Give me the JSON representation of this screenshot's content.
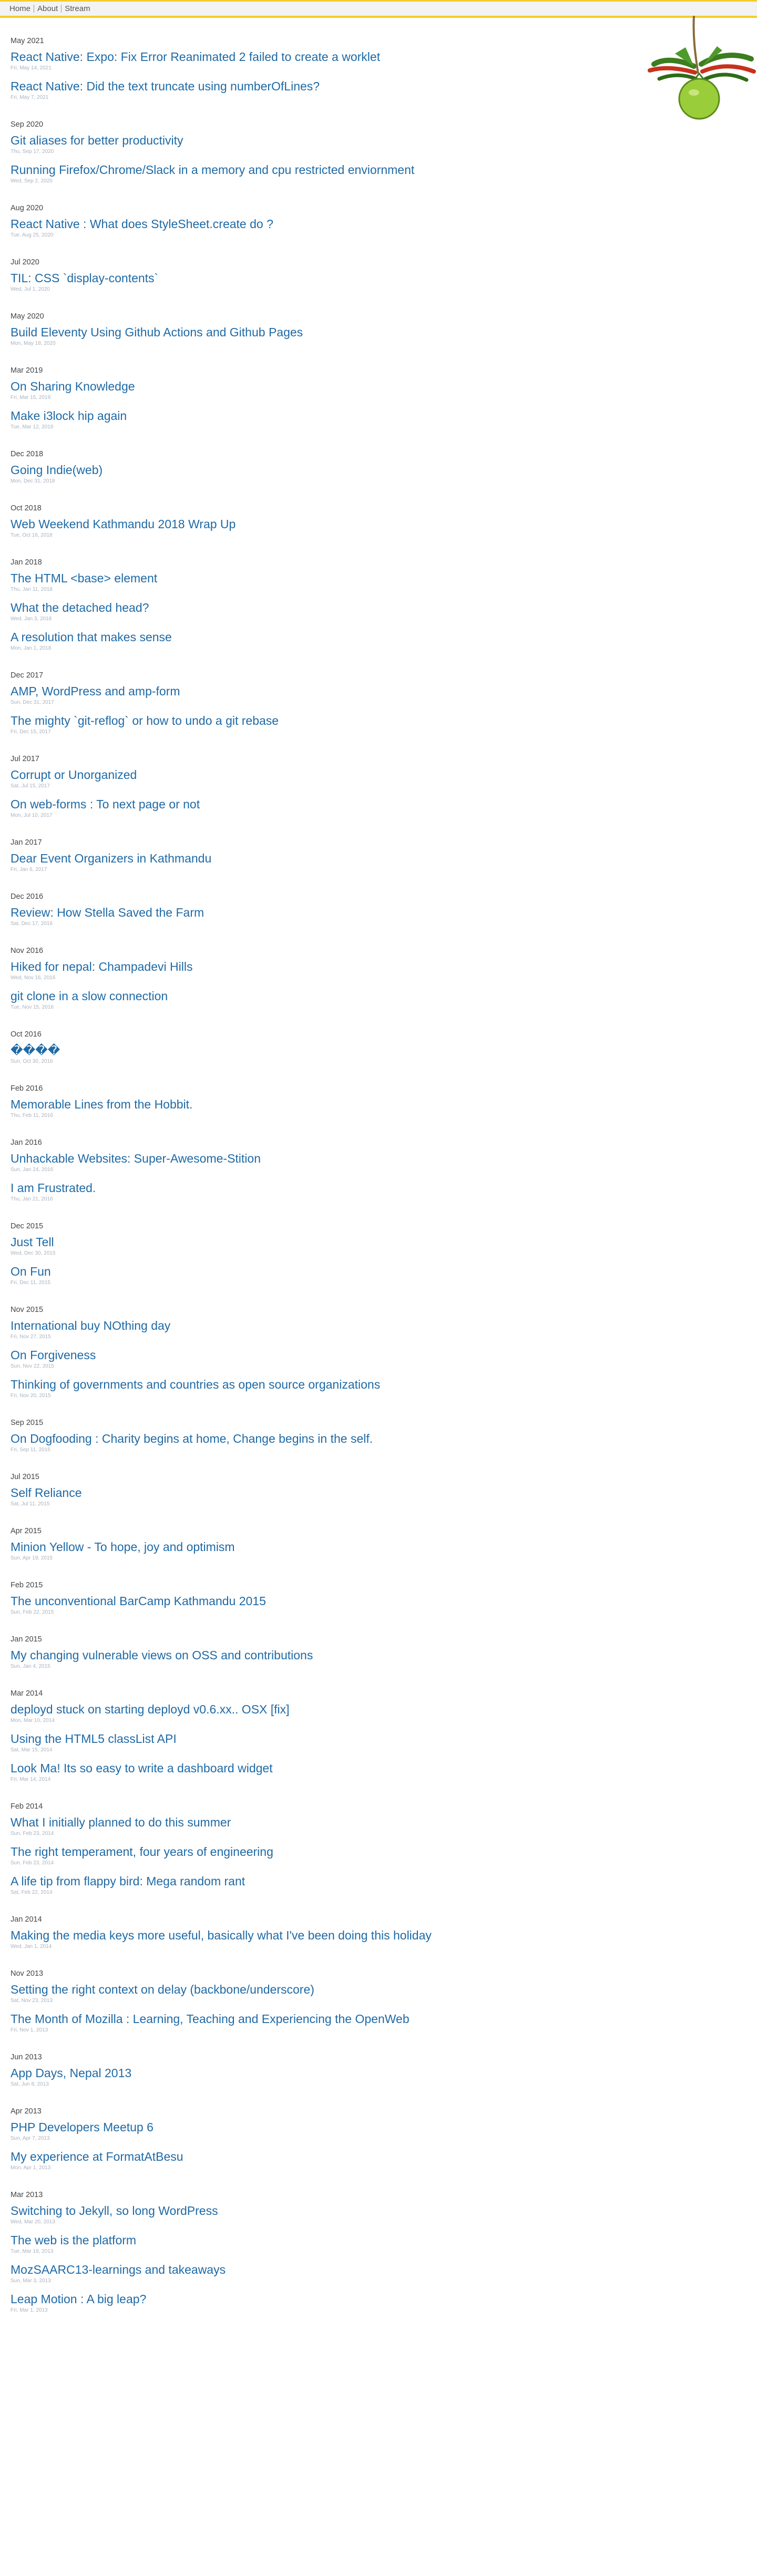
{
  "nav": {
    "home": "Home",
    "about": "About",
    "stream": "Stream"
  },
  "decoration": {
    "icon": "rope-tomato-chillies-illustration",
    "colors": {
      "leaves": "#3b7d1f",
      "lime": "#9acd3a",
      "chilli": "#c8311c",
      "rope": "#8a6a3c"
    }
  },
  "colors": {
    "link": "#1f6aa6",
    "month": "#444444",
    "date": "#aab3bf",
    "accent": "#f5cc2a"
  },
  "groups": [
    {
      "month": "May 2021",
      "posts": [
        {
          "title": "React Native: Expo: Fix Error Reanimated 2 failed to create a worklet",
          "date": "Fri, May 14, 2021"
        },
        {
          "title": "React Native: Did the text truncate using numberOfLines?",
          "date": "Fri, May 7, 2021"
        }
      ]
    },
    {
      "month": "Sep 2020",
      "posts": [
        {
          "title": "Git aliases for better productivity",
          "date": "Thu, Sep 17, 2020"
        },
        {
          "title": "Running Firefox/Chrome/Slack in a memory and cpu restricted enviornment",
          "date": "Wed, Sep 2, 2020"
        }
      ]
    },
    {
      "month": "Aug 2020",
      "posts": [
        {
          "title": "React Native : What does StyleSheet.create do ?",
          "date": "Tue, Aug 25, 2020"
        }
      ]
    },
    {
      "month": "Jul 2020",
      "posts": [
        {
          "title": "TIL: CSS `display-contents`",
          "date": "Wed, Jul 1, 2020"
        }
      ]
    },
    {
      "month": "May 2020",
      "posts": [
        {
          "title": "Build Eleventy Using Github Actions and Github Pages",
          "date": "Mon, May 18, 2020"
        }
      ]
    },
    {
      "month": "Mar 2019",
      "posts": [
        {
          "title": "On Sharing Knowledge",
          "date": "Fri, Mar 15, 2019"
        },
        {
          "title": "Make i3lock hip again",
          "date": "Tue, Mar 12, 2019"
        }
      ]
    },
    {
      "month": "Dec 2018",
      "posts": [
        {
          "title": "Going Indie(web)",
          "date": "Mon, Dec 31, 2018"
        }
      ]
    },
    {
      "month": "Oct 2018",
      "posts": [
        {
          "title": "Web Weekend Kathmandu 2018 Wrap Up",
          "date": "Tue, Oct 16, 2018"
        }
      ]
    },
    {
      "month": "Jan 2018",
      "posts": [
        {
          "title": "The HTML <base> element",
          "date": "Thu, Jan 11, 2018"
        },
        {
          "title": "What the detached head?",
          "date": "Wed, Jan 3, 2018"
        },
        {
          "title": "A resolution that makes sense",
          "date": "Mon, Jan 1, 2018"
        }
      ]
    },
    {
      "month": "Dec 2017",
      "posts": [
        {
          "title": "AMP, WordPress and amp-form",
          "date": "Sun, Dec 31, 2017"
        },
        {
          "title": "The mighty `git-reflog` or how to undo a git rebase",
          "date": "Fri, Dec 15, 2017"
        }
      ]
    },
    {
      "month": "Jul 2017",
      "posts": [
        {
          "title": "Corrupt or Unorganized",
          "date": "Sat, Jul 15, 2017"
        },
        {
          "title": "On web-forms : To next page or not",
          "date": "Mon, Jul 10, 2017"
        }
      ]
    },
    {
      "month": "Jan 2017",
      "posts": [
        {
          "title": "Dear Event Organizers in Kathmandu",
          "date": "Fri, Jan 6, 2017"
        }
      ]
    },
    {
      "month": "Dec 2016",
      "posts": [
        {
          "title": "Review: How Stella Saved the Farm",
          "date": "Sat, Dec 17, 2016"
        }
      ]
    },
    {
      "month": "Nov 2016",
      "posts": [
        {
          "title": "Hiked for nepal: Champadevi Hills",
          "date": "Wed, Nov 16, 2016"
        },
        {
          "title": "git clone in a slow connection",
          "date": "Tue, Nov 15, 2016"
        }
      ]
    },
    {
      "month": "Oct 2016",
      "posts": [
        {
          "title": "����",
          "date": "Sun, Oct 30, 2016"
        }
      ]
    },
    {
      "month": "Feb 2016",
      "posts": [
        {
          "title": "Memorable Lines from the Hobbit.",
          "date": "Thu, Feb 11, 2016"
        }
      ]
    },
    {
      "month": "Jan 2016",
      "posts": [
        {
          "title": "Unhackable Websites: Super-Awesome-Stition",
          "date": "Sun, Jan 24, 2016"
        },
        {
          "title": "I am Frustrated.",
          "date": "Thu, Jan 21, 2016"
        }
      ]
    },
    {
      "month": "Dec 2015",
      "posts": [
        {
          "title": "Just Tell",
          "date": "Wed, Dec 30, 2015"
        },
        {
          "title": "On Fun",
          "date": "Fri, Dec 11, 2015"
        }
      ]
    },
    {
      "month": "Nov 2015",
      "posts": [
        {
          "title": "International buy NOthing day",
          "date": "Fri, Nov 27, 2015"
        },
        {
          "title": "On Forgiveness",
          "date": "Sun, Nov 22, 2015"
        },
        {
          "title": "Thinking of governments and countries as open source organizations",
          "date": "Fri, Nov 20, 2015"
        }
      ]
    },
    {
      "month": "Sep 2015",
      "posts": [
        {
          "title": "On Dogfooding : Charity begins at home, Change begins in the self.",
          "date": "Fri, Sep 11, 2015"
        }
      ]
    },
    {
      "month": "Jul 2015",
      "posts": [
        {
          "title": "Self Reliance",
          "date": "Sat, Jul 11, 2015"
        }
      ]
    },
    {
      "month": "Apr 2015",
      "posts": [
        {
          "title": "Minion Yellow - To hope, joy and optimism",
          "date": "Sun, Apr 19, 2015"
        }
      ]
    },
    {
      "month": "Feb 2015",
      "posts": [
        {
          "title": "The unconventional BarCamp Kathmandu 2015",
          "date": "Sun, Feb 22, 2015"
        }
      ]
    },
    {
      "month": "Jan 2015",
      "posts": [
        {
          "title": "My changing vulnerable views on OSS and contributions",
          "date": "Sun, Jan 4, 2015"
        }
      ]
    },
    {
      "month": "Mar 2014",
      "posts": [
        {
          "title": "deployd stuck on starting deployd v0.6.xx.. OSX [fix]",
          "date": "Mon, Mar 10, 2014"
        },
        {
          "title": "Using the HTML5 classList API",
          "date": "Sat, Mar 15, 2014"
        },
        {
          "title": "Look Ma! Its so easy to write a dashboard widget",
          "date": "Fri, Mar 14, 2014"
        }
      ]
    },
    {
      "month": "Feb 2014",
      "posts": [
        {
          "title": "What I initially planned to do this summer",
          "date": "Sun, Feb 23, 2014"
        },
        {
          "title": "The right temperament, four years of engineering",
          "date": "Sun, Feb 23, 2014"
        },
        {
          "title": "A life tip from flappy bird: Mega random rant",
          "date": "Sat, Feb 22, 2014"
        }
      ]
    },
    {
      "month": "Jan 2014",
      "posts": [
        {
          "title": "Making the media keys more useful, basically what I've been doing this holiday",
          "date": "Wed, Jan 1, 2014"
        }
      ]
    },
    {
      "month": "Nov 2013",
      "posts": [
        {
          "title": "Setting the right context on delay (backbone/underscore)",
          "date": "Sat, Nov 23, 2013"
        },
        {
          "title": "The Month of Mozilla : Learning, Teaching and Experiencing the OpenWeb",
          "date": "Fri, Nov 1, 2013"
        }
      ]
    },
    {
      "month": "Jun 2013",
      "posts": [
        {
          "title": "App Days, Nepal 2013",
          "date": "Sat, Jun 8, 2013"
        }
      ]
    },
    {
      "month": "Apr 2013",
      "posts": [
        {
          "title": "PHP Developers Meetup 6",
          "date": "Sun, Apr 7, 2013"
        },
        {
          "title": "My experience at FormatAtBesu",
          "date": "Mon, Apr 1, 2013"
        }
      ]
    },
    {
      "month": "Mar 2013",
      "posts": [
        {
          "title": "Switching to Jekyll, so long WordPress",
          "date": "Wed, Mar 20, 2013"
        },
        {
          "title": "The web is the platform",
          "date": "Tue, Mar 19, 2013"
        },
        {
          "title": "MozSAARC13-learnings and takeaways",
          "date": "Sun, Mar 3, 2013"
        },
        {
          "title": "Leap Motion : A big leap?",
          "date": "Fri, Mar 1, 2013"
        }
      ]
    }
  ]
}
